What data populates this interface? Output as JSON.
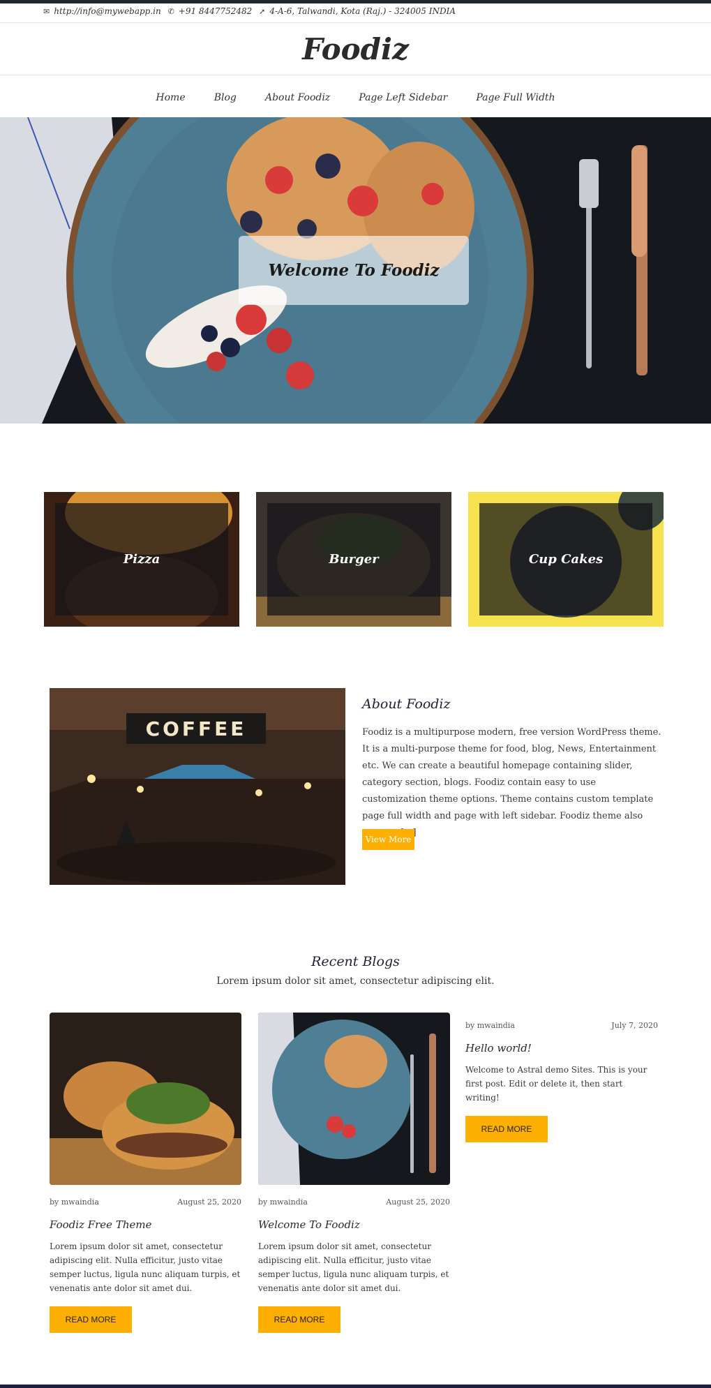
{
  "topbar": {
    "email": "http://info@mywebapp.in",
    "phone": "+91 8447752482",
    "address": "4-A-6, Talwandi, Kota (Raj.) - 324005 INDIA"
  },
  "site": {
    "title": "Foodiz"
  },
  "nav": {
    "items": [
      "Home",
      "Blog",
      "About Foodiz",
      "Page Left Sidebar",
      "Page Full Width"
    ]
  },
  "hero": {
    "title": "Welcome To Foodiz"
  },
  "categories": [
    {
      "label": "Pizza"
    },
    {
      "label": "Burger"
    },
    {
      "label": "Cup Cakes"
    }
  ],
  "about": {
    "image_text": "COFFEE",
    "title": "About Foodiz",
    "text": "Foodiz is a multipurpose modern, free version WordPress theme. It is a multi-purpose theme for food, blog, News, Entertainment etc. We can create a beautiful homepage containing slider, category section, blogs. Foodiz contain easy to use customization theme options. Theme contains custom template page full width and page with left sidebar. Foodiz theme also support [...]",
    "button": "View More"
  },
  "recent_blogs": {
    "title": "Recent Blogs",
    "subtitle": "Lorem ipsum dolor sit amet, consectetur adipiscing elit.",
    "posts": [
      {
        "author": "by mwaindia",
        "date": "August 25, 2020",
        "title": "Foodiz Free Theme",
        "excerpt": "Lorem ipsum dolor sit amet, consectetur adipiscing elit. Nulla efficitur, justo vitae semper luctus, ligula nunc aliquam turpis, et venenatis ante dolor sit amet dui.",
        "button": "READ MORE"
      },
      {
        "author": "by mwaindia",
        "date": "August 25, 2020",
        "title": "Welcome To Foodiz",
        "excerpt": "Lorem ipsum dolor sit amet, consectetur adipiscing elit. Nulla efficitur, justo vitae semper luctus, ligula nunc aliquam turpis, et venenatis ante dolor sit amet dui.",
        "button": "READ MORE"
      },
      {
        "author": "by mwaindia",
        "date": "July 7, 2020",
        "title": "Hello world!",
        "excerpt": "Welcome to Astral demo Sites. This is your first post. Edit or delete it, then start writing!",
        "button": "READ MORE"
      }
    ]
  },
  "colors": {
    "accent": "#fdb003",
    "dark": "#22262e",
    "heading": "#1f1f3a"
  },
  "icons": {
    "email": "envelope-icon",
    "phone": "phone-icon",
    "address": "location-arrow-icon"
  }
}
